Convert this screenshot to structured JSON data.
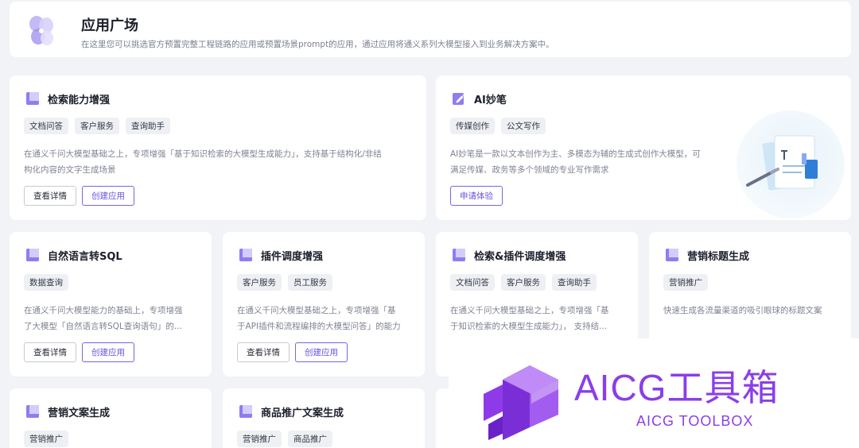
{
  "header": {
    "title": "应用广场",
    "description": "在这里您可以挑选官方预置完整工程链路的应用或预置场景prompt的应用，通过应用将通义系列大模型接入到业务解决方案中。"
  },
  "cards": [
    {
      "title": "检索能力增强",
      "icon": "bookmark-icon",
      "tags": [
        "文档问答",
        "客户服务",
        "查询助手"
      ],
      "desc": [
        "在通义千问大模型基础之上，专项增强「基于知识检索的大模型生成能力」，支持基于结构化/非结",
        "构化内容的文字生成场景"
      ],
      "buttons": [
        "查看详情",
        "创建应用"
      ]
    },
    {
      "title": "AI妙笔",
      "icon": "edit-icon",
      "tags": [
        "传媒创作",
        "公文写作"
      ],
      "desc": [
        "AI妙笔是一款以文本创作为主、多模态为辅的生成式创作大模型，可",
        "满足传媒、政务等多个领域的专业写作需求"
      ],
      "buttons": [
        "申请体验"
      ]
    },
    {
      "title": "自然语言转SQL",
      "icon": "bookmark-icon",
      "tags": [
        "数据查询"
      ],
      "desc": [
        "在通义千问大模型能力的基础上，专项增强",
        "了大模型「自然语言转SQL查询语句」的..."
      ],
      "buttons": [
        "查看详情",
        "创建应用"
      ]
    },
    {
      "title": "插件调度增强",
      "icon": "bookmark-icon",
      "tags": [
        "客户服务",
        "员工服务"
      ],
      "desc": [
        "在通义千问大模型基础之上，专项增强「基",
        "于API插件和流程编排的大模型问答」的能力"
      ],
      "buttons": [
        "查看详情",
        "创建应用"
      ]
    },
    {
      "title": "检索&插件调度增强",
      "icon": "bookmark-icon",
      "tags": [
        "文档问答",
        "客户服务",
        "查询助手"
      ],
      "desc": [
        "在通义千问大模型基础之上，专项增强「基",
        "于知识检索的大模型生成能力」，  支持结..."
      ],
      "buttons": []
    },
    {
      "title": "营销标题生成",
      "icon": "bookmark-icon",
      "tags": [
        "营销推广"
      ],
      "desc": [
        "快速生成各流量渠道的吸引眼球的标题文案"
      ],
      "buttons": []
    },
    {
      "title": "营销文案生成",
      "icon": "bookmark-icon",
      "tags": [
        "营销推广"
      ],
      "desc": [],
      "buttons": []
    },
    {
      "title": "商品推广文案生成",
      "icon": "bookmark-icon",
      "tags": [
        "营销推广",
        "商品推广"
      ],
      "desc": [],
      "buttons": []
    }
  ],
  "watermark": {
    "title": "AICG工具箱",
    "subtitle": "AICG TOOLBOX"
  },
  "colors": {
    "accent": "#7a63e8",
    "icon_purple": "#7b68ee",
    "watermark": "#8b3ee8"
  }
}
